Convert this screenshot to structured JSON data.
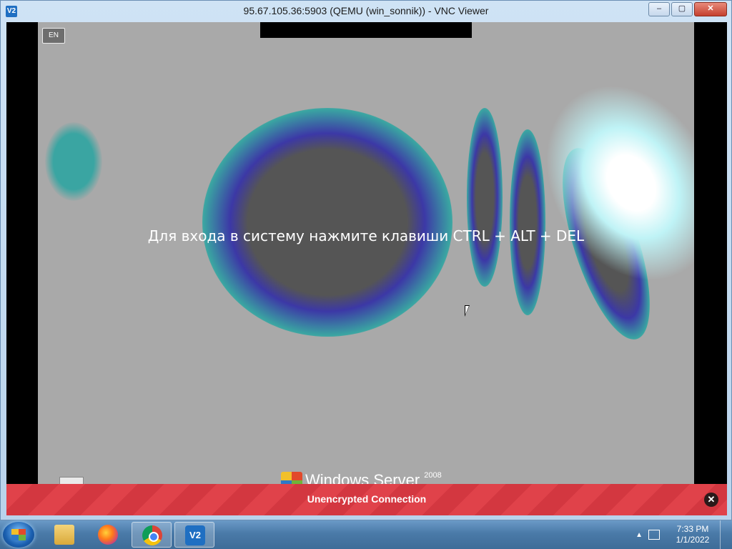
{
  "window": {
    "title": "95.67.105.36:5903 (QEMU (win_sonnik)) - VNC Viewer",
    "app_icon": "vnc-icon",
    "app_icon_text": "V2",
    "buttons": {
      "minimize": "–",
      "maximize": "▢",
      "close": "✕"
    }
  },
  "remote": {
    "logon_message": "Для входа в систему нажмите клавиши CTRL + ALT + DEL",
    "logo_text": "Windows Server",
    "logo_version": "2008",
    "kbd_icon": "keyboard-layout-icon",
    "background_color": "#a9a9a9"
  },
  "banner": {
    "text": "Unencrypted Connection",
    "close_icon": "close-icon",
    "color": "#e0424a"
  },
  "taskbar": {
    "items": [
      {
        "name": "explorer",
        "icon": "folder-icon"
      },
      {
        "name": "firefox",
        "icon": "firefox-icon"
      },
      {
        "name": "chrome",
        "icon": "chrome-icon",
        "active": true
      },
      {
        "name": "vnc-viewer",
        "icon": "vnc-icon",
        "active": true,
        "label": "V2"
      }
    ],
    "clock": {
      "time": "7:33 PM",
      "date": "1/1/2022"
    }
  }
}
